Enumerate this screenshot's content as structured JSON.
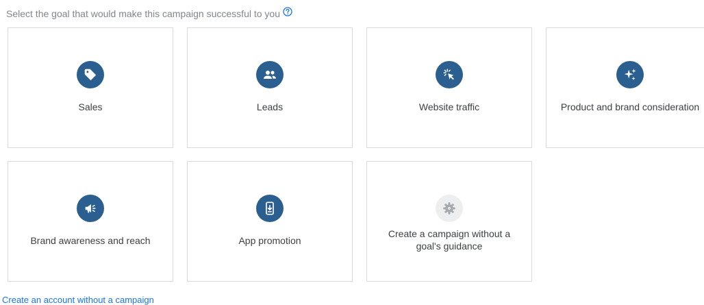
{
  "header": {
    "title": "Select the goal that would make this campaign successful to you",
    "help_icon": "help-circle-icon"
  },
  "goals": [
    {
      "label": "Sales",
      "icon": "tag-icon"
    },
    {
      "label": "Leads",
      "icon": "people-icon"
    },
    {
      "label": "Website traffic",
      "icon": "cursor-click-icon"
    },
    {
      "label": "Product and brand consideration",
      "icon": "sparkle-icon"
    },
    {
      "label": "Brand awareness and reach",
      "icon": "megaphone-icon"
    },
    {
      "label": "App promotion",
      "icon": "mobile-download-icon"
    },
    {
      "label": "Create a campaign without a goal's guidance",
      "icon": "gear-icon"
    }
  ],
  "footer": {
    "link_label": "Create an account without a campaign"
  },
  "colors": {
    "icon_circle": "#2b5f8f",
    "icon_circle_disabled": "#eceeef",
    "link": "#1a73e8",
    "card_border": "#d7d9dc"
  }
}
